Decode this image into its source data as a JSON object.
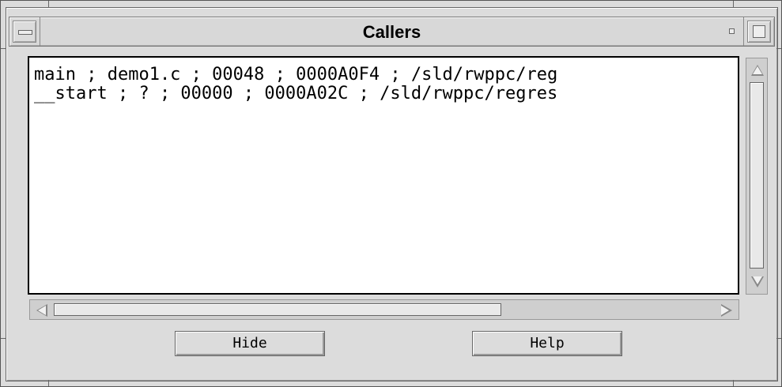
{
  "window": {
    "title": "Callers"
  },
  "callers": {
    "lines": [
      "main ; demo1.c ; 00048 ; 0000A0F4 ; /sld/rwppc/reg",
      "__start ; ? ; 00000 ; 0000A02C ; /sld/rwppc/regres"
    ]
  },
  "buttons": {
    "hide": "Hide",
    "help": "Help"
  },
  "scrollbars": {
    "vertical_position": 0.0,
    "horizontal_position": 0.0,
    "horizontal_visible_fraction": 0.66
  },
  "icons": {
    "window_menu": "window-menu-icon",
    "minimize": "minimize-icon",
    "maximize": "maximize-icon"
  },
  "colors": {
    "window_bg": "#dcdcdc",
    "text_bg": "#ffffff",
    "text": "#000000"
  }
}
